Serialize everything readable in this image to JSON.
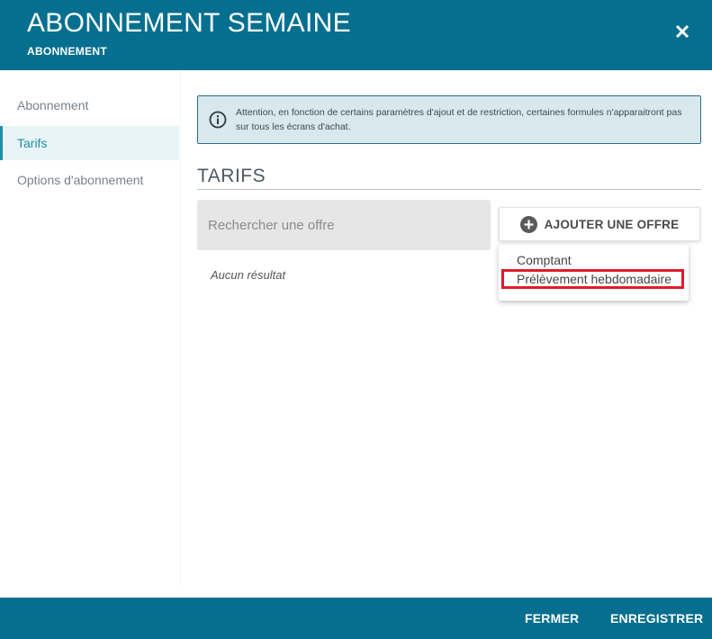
{
  "header": {
    "title": "ABONNEMENT SEMAINE",
    "subtitle": "ABONNEMENT"
  },
  "sidebar": {
    "items": [
      {
        "label": "Abonnement",
        "active": false
      },
      {
        "label": "Tarifs",
        "active": true
      },
      {
        "label": "Options d'abonnement",
        "active": false
      }
    ]
  },
  "notice": {
    "text": "Attention, en fonction de certains paramètres d'ajout et de restriction, certaines formules n'apparaitront pas sur tous les écrans d'achat."
  },
  "section": {
    "title": "TARIFS"
  },
  "search": {
    "placeholder": "Rechercher une offre",
    "value": ""
  },
  "add_button": {
    "label": "AJOUTER UNE OFFRE"
  },
  "results": {
    "empty_text": "Aucun résultat"
  },
  "dropdown": {
    "options": [
      {
        "label": "Comptant",
        "highlighted": false
      },
      {
        "label": "Prélèvement hebdomadaire",
        "highlighted": true
      }
    ]
  },
  "footer": {
    "close_label": "FERMER",
    "save_label": "ENREGISTRER"
  },
  "colors": {
    "primary": "#056f8f",
    "notice_bg": "#d8e8ed",
    "notice_border": "#2b6f85",
    "highlight_border": "#e01b2b",
    "active_sidebar": "#1f8fac"
  }
}
